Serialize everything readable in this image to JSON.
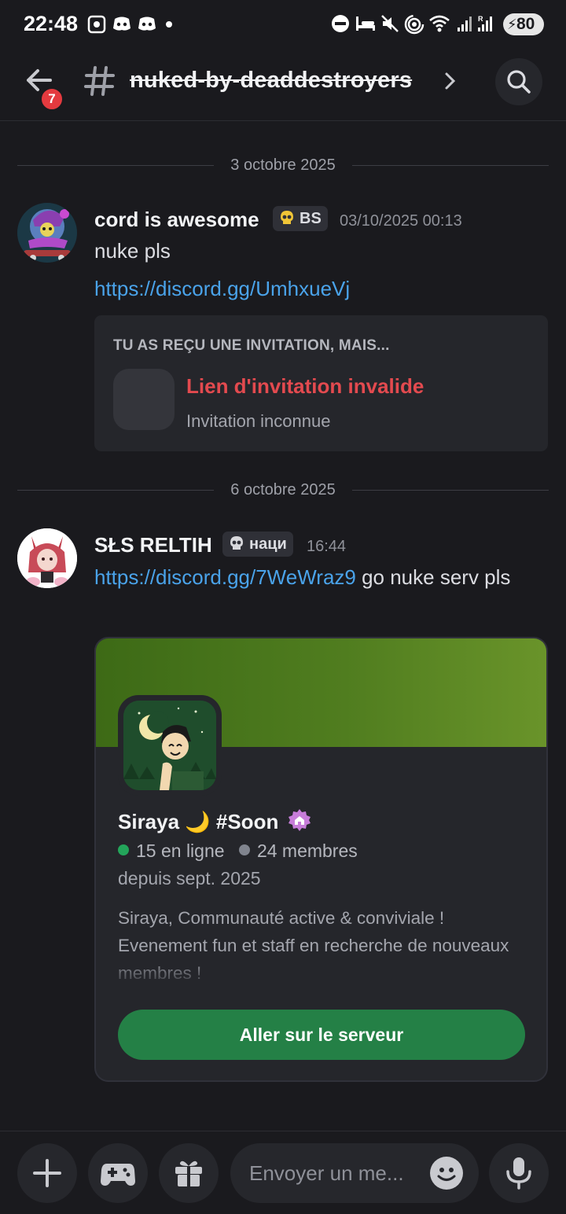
{
  "status_bar": {
    "time": "22:48",
    "battery": "80"
  },
  "header": {
    "channel_name": "nuked-by-deaddestroyers",
    "unread_badge": "7"
  },
  "messages": [
    {
      "date_divider": "3 octobre 2025",
      "author": "cord is awesome",
      "tag": "BS",
      "timestamp": "03/10/2025 00:13",
      "text": "nuke pls",
      "link": "https://discord.gg/UmhxueVj",
      "invite": {
        "heading": "TU AS REÇU UNE INVITATION, MAIS...",
        "title": "Lien d'invitation invalide",
        "subtitle": "Invitation inconnue"
      }
    },
    {
      "date_divider": "6 octobre 2025",
      "author": "SŁS RELTIH",
      "tag": "наци",
      "timestamp": "16:44",
      "link": "https://discord.gg/7WeWraz9",
      "text_after_link": " go nuke serv pls",
      "invite": {
        "server_name": "Siraya 🌙 #Soon",
        "online": "15 en ligne",
        "members": "24 membres",
        "since": "depuis sept. 2025",
        "description": "Siraya, Communauté active & conviviale ! Evenement fun et staff en recherche de nouveaux membres !",
        "join_label": "Aller sur le serveur"
      }
    }
  ],
  "composer": {
    "placeholder": "Envoyer un me..."
  },
  "colors": {
    "link": "#4aa3ea",
    "online": "#23a55a",
    "join_button": "#248046",
    "invalid": "#e34a4f"
  },
  "icons": [
    "back-arrow-icon",
    "hash-icon",
    "chevron-right-icon",
    "search-icon",
    "skull-icon",
    "plus-icon",
    "gamepad-icon",
    "gift-icon",
    "emoji-icon",
    "mic-icon"
  ]
}
